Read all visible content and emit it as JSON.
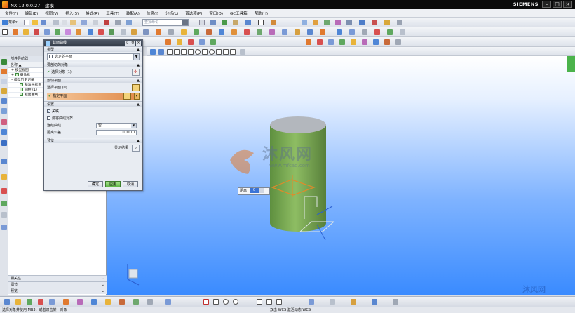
{
  "window": {
    "title": "NX 12.0.0.27 - 建模",
    "brand": "SIEMENS",
    "controls": [
      "–",
      "□",
      "×"
    ]
  },
  "menu": [
    "文件(F)",
    "编辑(E)",
    "视图(V)",
    "插入(S)",
    "格式(R)",
    "工具(T)",
    "装配(A)",
    "信息(I)",
    "分析(L)",
    "首选项(P)",
    "窗口(O)",
    "GC工具箱",
    "帮助(H)"
  ],
  "toolbar": {
    "command_label": "菜单▾",
    "search_placeholder": "查找命令"
  },
  "navigator": {
    "title": "部件导航器",
    "column_header": "名称 ▲",
    "nodes": [
      {
        "label": "模型视图",
        "check": false
      },
      {
        "label": "摄像机",
        "check": true
      },
      {
        "label": "模型历史记录",
        "check": false
      },
      {
        "label": "基准坐标系",
        "check": true
      },
      {
        "label": "圆柱 (1)",
        "check": true
      },
      {
        "label": "截面曲线",
        "check": true
      }
    ],
    "bottom_panels": [
      "相关性",
      "细节",
      "预览"
    ]
  },
  "dialog": {
    "title": "截面曲线",
    "sections": {
      "type": {
        "header": "类型",
        "value": "选定的平面"
      },
      "object": {
        "header": "要剖切的对象",
        "row": "选择对象 (1)"
      },
      "plane": {
        "header": "剖切平面",
        "row1": "选择平面 (0)",
        "row2": "指定平面"
      },
      "settings": {
        "header": "设置",
        "associative": "关联",
        "group": "要将曲线对齐",
        "join_label": "连结曲线",
        "join_value": "否",
        "tolerance_label": "距离公差",
        "tolerance_value": "0.0010"
      },
      "preview": {
        "header": "预览",
        "show_result": "显示结果"
      }
    },
    "buttons": {
      "ok": "确定",
      "apply": "应用",
      "cancel": "取消"
    }
  },
  "viewport": {
    "distance_label": "距离",
    "distance_value": "0",
    "watermark_main": "沐风网",
    "watermark_sub": "www.mfcad.com",
    "corner_logo": "沐风网"
  },
  "status": {
    "left": "选择对象并使用 MB3，或者双击某一对象",
    "center": "双击 WCS 激活动态 WCS"
  }
}
